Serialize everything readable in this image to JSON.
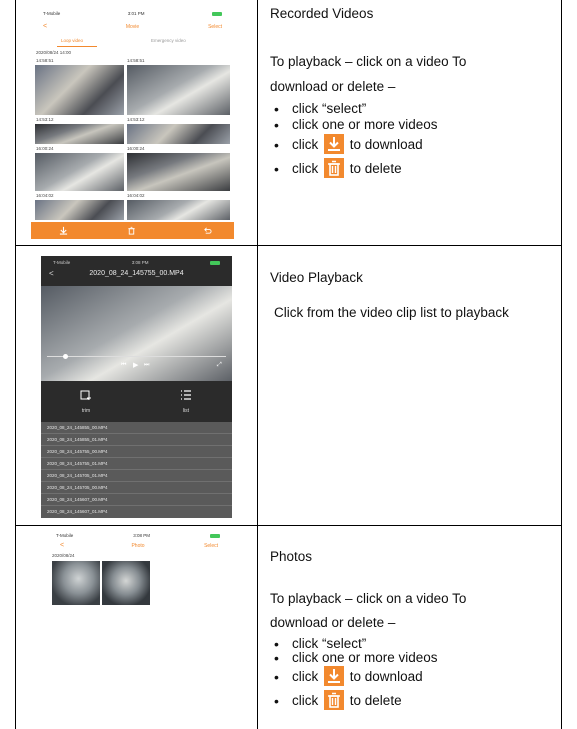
{
  "sections": [
    {
      "title": "Recorded Videos",
      "intro_line1": "To playback – click on a video To",
      "intro_line2": "download or delete –",
      "bullets": {
        "b1": "click “select”",
        "b2": "click one or more videos",
        "b3_pre": "click",
        "b3_post": "to download",
        "b4_pre": "click",
        "b4_post": "to delete"
      }
    },
    {
      "title": "Video Playback",
      "body": "Click from the video clip list to playback"
    },
    {
      "title": "Photos",
      "intro_line1": "To playback – click on a video To",
      "intro_line2": "download or delete –",
      "bullets": {
        "b1": "click “select”",
        "b2": "click one or more videos",
        "b3_pre": "click",
        "b3_post": "to download",
        "b4_pre": "click",
        "b4_post": "to delete"
      }
    }
  ],
  "phone1": {
    "carrier": "T-Mobile",
    "time": "3:01 PM",
    "back": "<",
    "title": "Movie",
    "select": "Select",
    "tab_loop": "Loop video",
    "tab_emergency": "Emergency video",
    "date": "2020/08/24 14:00",
    "stamps": [
      "14:58:51",
      "14:58:51",
      "14:53:12",
      "14:53:12",
      "16:00:24",
      "16:00:24",
      "16:04:02",
      "16:04:02"
    ]
  },
  "phone2": {
    "carrier": "T-Mobile",
    "time": "3:08 PM",
    "back": "<",
    "title": "2020_08_24_145755_00.MP4",
    "btn_trim": "trim",
    "btn_list": "list",
    "files": [
      "2020_08_24_145855_00.MP4",
      "2020_08_24_145855_01.MP4",
      "2020_08_24_145755_00.MP4",
      "2020_08_24_145755_01.MP4",
      "2020_08_24_145705_01.MP4",
      "2020_08_24_145705_00.MP4",
      "2020_08_24_145607_00.MP4",
      "2020_08_24_145607_01.MP4"
    ]
  },
  "phone3": {
    "carrier": "T-Mobile",
    "time": "3:08 PM",
    "back": "<",
    "title": "Photo",
    "select": "Select",
    "date": "2020/08/24"
  },
  "colors": {
    "accent": "#f2892e",
    "phone_dark": "#2b2b2b",
    "list_gray": "#5a5a5a"
  },
  "icons": {
    "download": "download-arrow-icon",
    "delete": "trash-icon"
  }
}
